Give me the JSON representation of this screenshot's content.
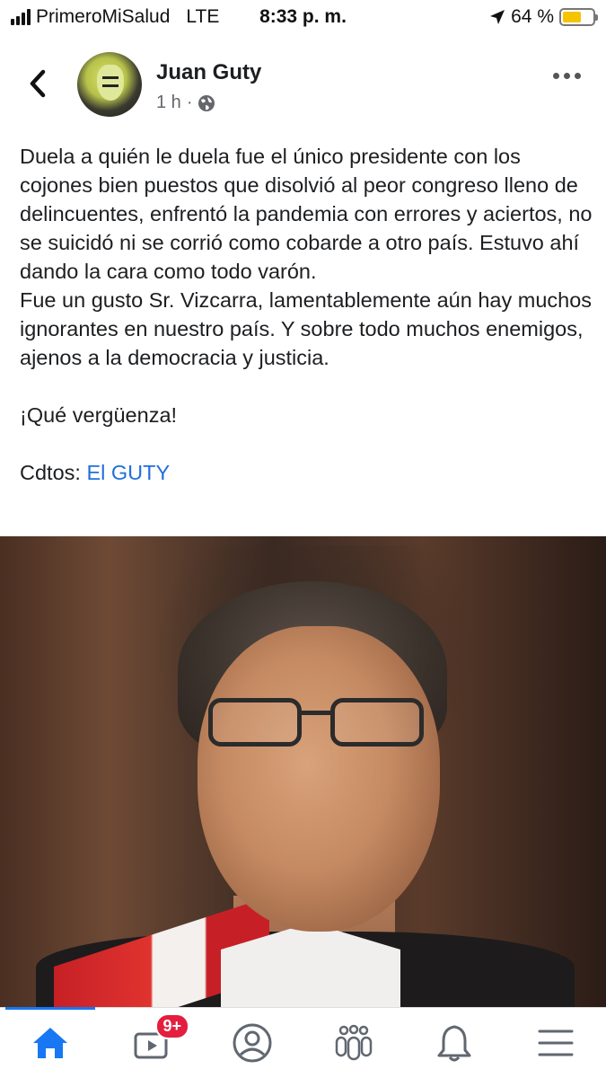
{
  "status_bar": {
    "carrier": "PrimeroMiSalud",
    "network": "LTE",
    "time": "8:33 p. m.",
    "battery_percent": "64 %",
    "battery_level": 0.64,
    "battery_color": "#f5c400"
  },
  "post": {
    "author": "Juan Guty",
    "time": "1 h",
    "separator": "·",
    "privacy_icon": "globe-icon",
    "paragraph1": "Duela a quién le duela fue el único presidente con los cojones bien puestos que disolvió al peor congreso lleno de delincuentes, enfrentó la pandemia con errores y aciertos, no se suicidó ni se corrió como cobarde a otro país. Estuvo ahí dando la cara como todo varón.",
    "paragraph2": "Fue un gusto Sr. Vizcarra, lamentablemente aún hay muchos ignorantes en nuestro país. Y sobre todo muchos enemigos, ajenos a la democracia y justicia.",
    "paragraph3": "¡Qué vergüenza!",
    "credits_label": "Cdtos:",
    "credits_link": "El GUTY",
    "link_color": "#216fdb"
  },
  "bottom_nav": {
    "items": [
      {
        "icon": "home-icon",
        "active": true
      },
      {
        "icon": "video-icon",
        "badge": "9+"
      },
      {
        "icon": "profile-icon"
      },
      {
        "icon": "groups-icon"
      },
      {
        "icon": "bell-icon"
      },
      {
        "icon": "menu-icon"
      }
    ],
    "accent_color": "#1877f2",
    "badge_color": "#e41e3f"
  }
}
